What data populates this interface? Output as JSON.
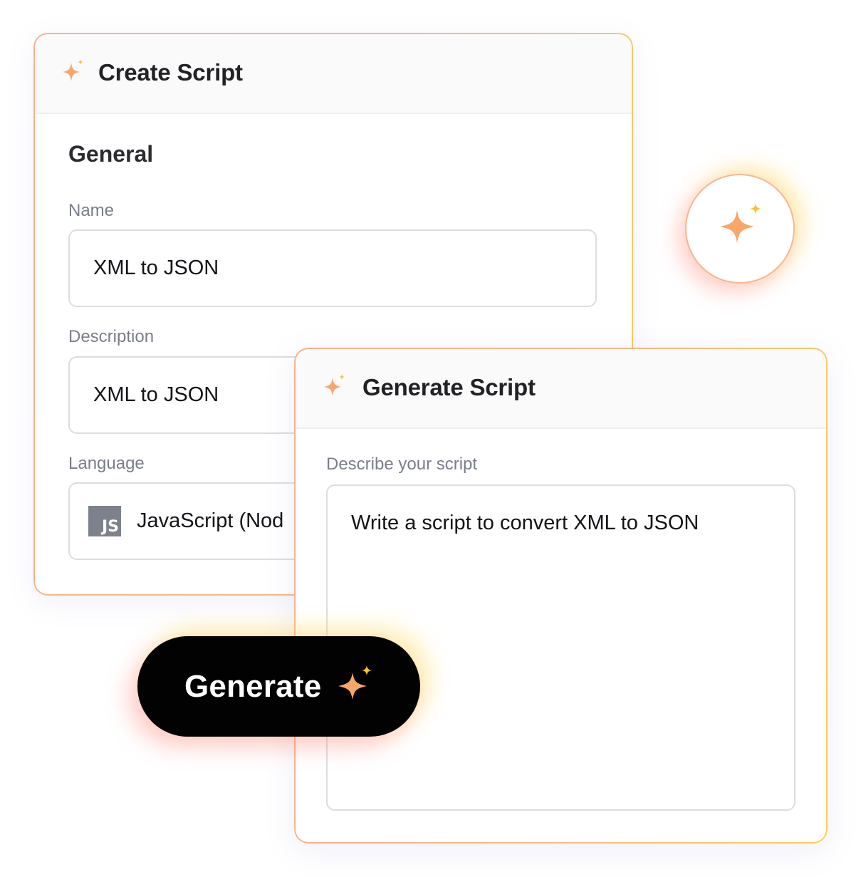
{
  "create_script": {
    "title": "Create Script",
    "section_title": "General",
    "name": {
      "label": "Name",
      "value": "XML to JSON"
    },
    "description": {
      "label": "Description",
      "value": "XML to JSON"
    },
    "language": {
      "label": "Language",
      "value": "JavaScript (Nod",
      "badge": "JS",
      "icon": "js-logo-icon"
    }
  },
  "generate_script": {
    "title": "Generate Script",
    "prompt_label": "Describe your script",
    "prompt_value": "Write a script to convert XML to JSON"
  },
  "generate_button": {
    "label": "Generate",
    "icon": "sparkle-icon"
  },
  "colors": {
    "sparkle_primary": "#f9a66c",
    "sparkle_accent": "#f7c23a",
    "button_bg": "#020202",
    "border_gradient_start": "#f7b08e",
    "border_gradient_end": "#f6cf58"
  }
}
